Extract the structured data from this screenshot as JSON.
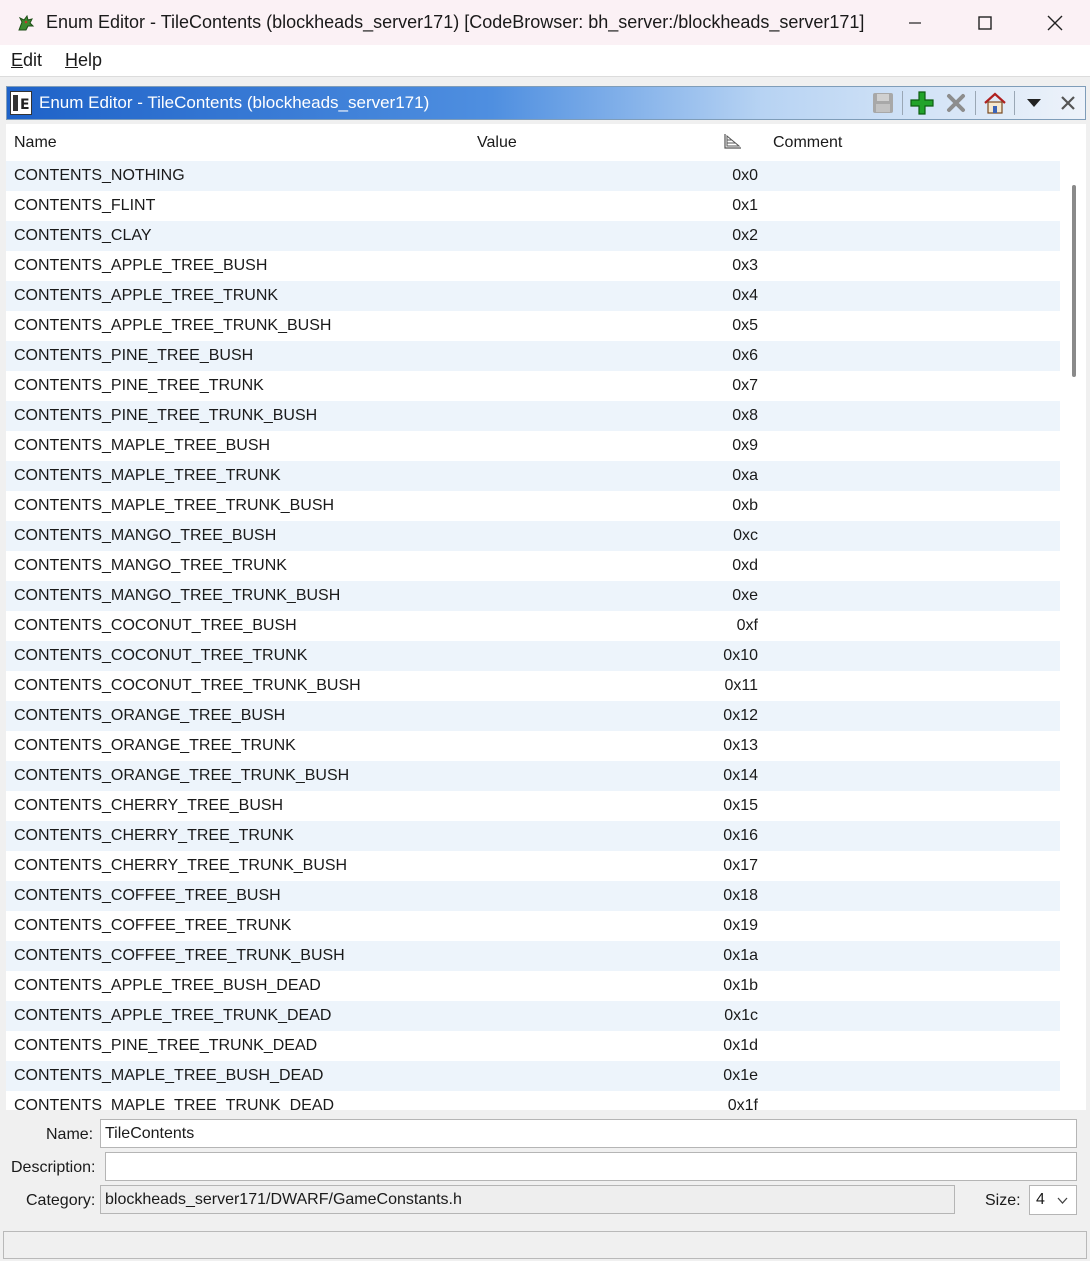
{
  "window": {
    "title": "Enum Editor - TileContents (blockheads_server171) [CodeBrowser: bh_server:/blockheads_server171]"
  },
  "menu": {
    "edit_first": "E",
    "edit_rest": "dit",
    "help_first": "H",
    "help_rest": "elp"
  },
  "panel": {
    "title": "Enum Editor - TileContents (blockheads_server171)",
    "accent": "#1e62c8"
  },
  "table": {
    "col_name": "Name",
    "col_value": "Value",
    "col_comment": "Comment",
    "rows": [
      {
        "name": "CONTENTS_NOTHING",
        "value": "0x0"
      },
      {
        "name": "CONTENTS_FLINT",
        "value": "0x1"
      },
      {
        "name": "CONTENTS_CLAY",
        "value": "0x2"
      },
      {
        "name": "CONTENTS_APPLE_TREE_BUSH",
        "value": "0x3"
      },
      {
        "name": "CONTENTS_APPLE_TREE_TRUNK",
        "value": "0x4"
      },
      {
        "name": "CONTENTS_APPLE_TREE_TRUNK_BUSH",
        "value": "0x5"
      },
      {
        "name": "CONTENTS_PINE_TREE_BUSH",
        "value": "0x6"
      },
      {
        "name": "CONTENTS_PINE_TREE_TRUNK",
        "value": "0x7"
      },
      {
        "name": "CONTENTS_PINE_TREE_TRUNK_BUSH",
        "value": "0x8"
      },
      {
        "name": "CONTENTS_MAPLE_TREE_BUSH",
        "value": "0x9"
      },
      {
        "name": "CONTENTS_MAPLE_TREE_TRUNK",
        "value": "0xa"
      },
      {
        "name": "CONTENTS_MAPLE_TREE_TRUNK_BUSH",
        "value": "0xb"
      },
      {
        "name": "CONTENTS_MANGO_TREE_BUSH",
        "value": "0xc"
      },
      {
        "name": "CONTENTS_MANGO_TREE_TRUNK",
        "value": "0xd"
      },
      {
        "name": "CONTENTS_MANGO_TREE_TRUNK_BUSH",
        "value": "0xe"
      },
      {
        "name": "CONTENTS_COCONUT_TREE_BUSH",
        "value": "0xf"
      },
      {
        "name": "CONTENTS_COCONUT_TREE_TRUNK",
        "value": "0x10"
      },
      {
        "name": "CONTENTS_COCONUT_TREE_TRUNK_BUSH",
        "value": "0x11"
      },
      {
        "name": "CONTENTS_ORANGE_TREE_BUSH",
        "value": "0x12"
      },
      {
        "name": "CONTENTS_ORANGE_TREE_TRUNK",
        "value": "0x13"
      },
      {
        "name": "CONTENTS_ORANGE_TREE_TRUNK_BUSH",
        "value": "0x14"
      },
      {
        "name": "CONTENTS_CHERRY_TREE_BUSH",
        "value": "0x15"
      },
      {
        "name": "CONTENTS_CHERRY_TREE_TRUNK",
        "value": "0x16"
      },
      {
        "name": "CONTENTS_CHERRY_TREE_TRUNK_BUSH",
        "value": "0x17"
      },
      {
        "name": "CONTENTS_COFFEE_TREE_BUSH",
        "value": "0x18"
      },
      {
        "name": "CONTENTS_COFFEE_TREE_TRUNK",
        "value": "0x19"
      },
      {
        "name": "CONTENTS_COFFEE_TREE_TRUNK_BUSH",
        "value": "0x1a"
      },
      {
        "name": "CONTENTS_APPLE_TREE_BUSH_DEAD",
        "value": "0x1b"
      },
      {
        "name": "CONTENTS_APPLE_TREE_TRUNK_DEAD",
        "value": "0x1c"
      },
      {
        "name": "CONTENTS_PINE_TREE_TRUNK_DEAD",
        "value": "0x1d"
      },
      {
        "name": "CONTENTS_MAPLE_TREE_BUSH_DEAD",
        "value": "0x1e"
      },
      {
        "name": "CONTENTS_MAPLE_TREE_TRUNK_DEAD",
        "value": "0x1f"
      }
    ]
  },
  "form": {
    "name_label": "Name:",
    "name_value": "TileContents",
    "description_label": "Description:",
    "description_value": "",
    "category_label": "Category:",
    "category_value": "blockheads_server171/DWARF/GameConstants.h",
    "size_label": "Size:",
    "size_value": "4"
  },
  "icons": {
    "app": "dragon-icon",
    "panel": "enum-editor-icon",
    "save": "save-icon",
    "add": "add-icon",
    "delete": "delete-icon",
    "home": "home-icon",
    "menu": "dropdown-triangle-icon",
    "close": "close-icon",
    "sort": "sort-icon"
  }
}
